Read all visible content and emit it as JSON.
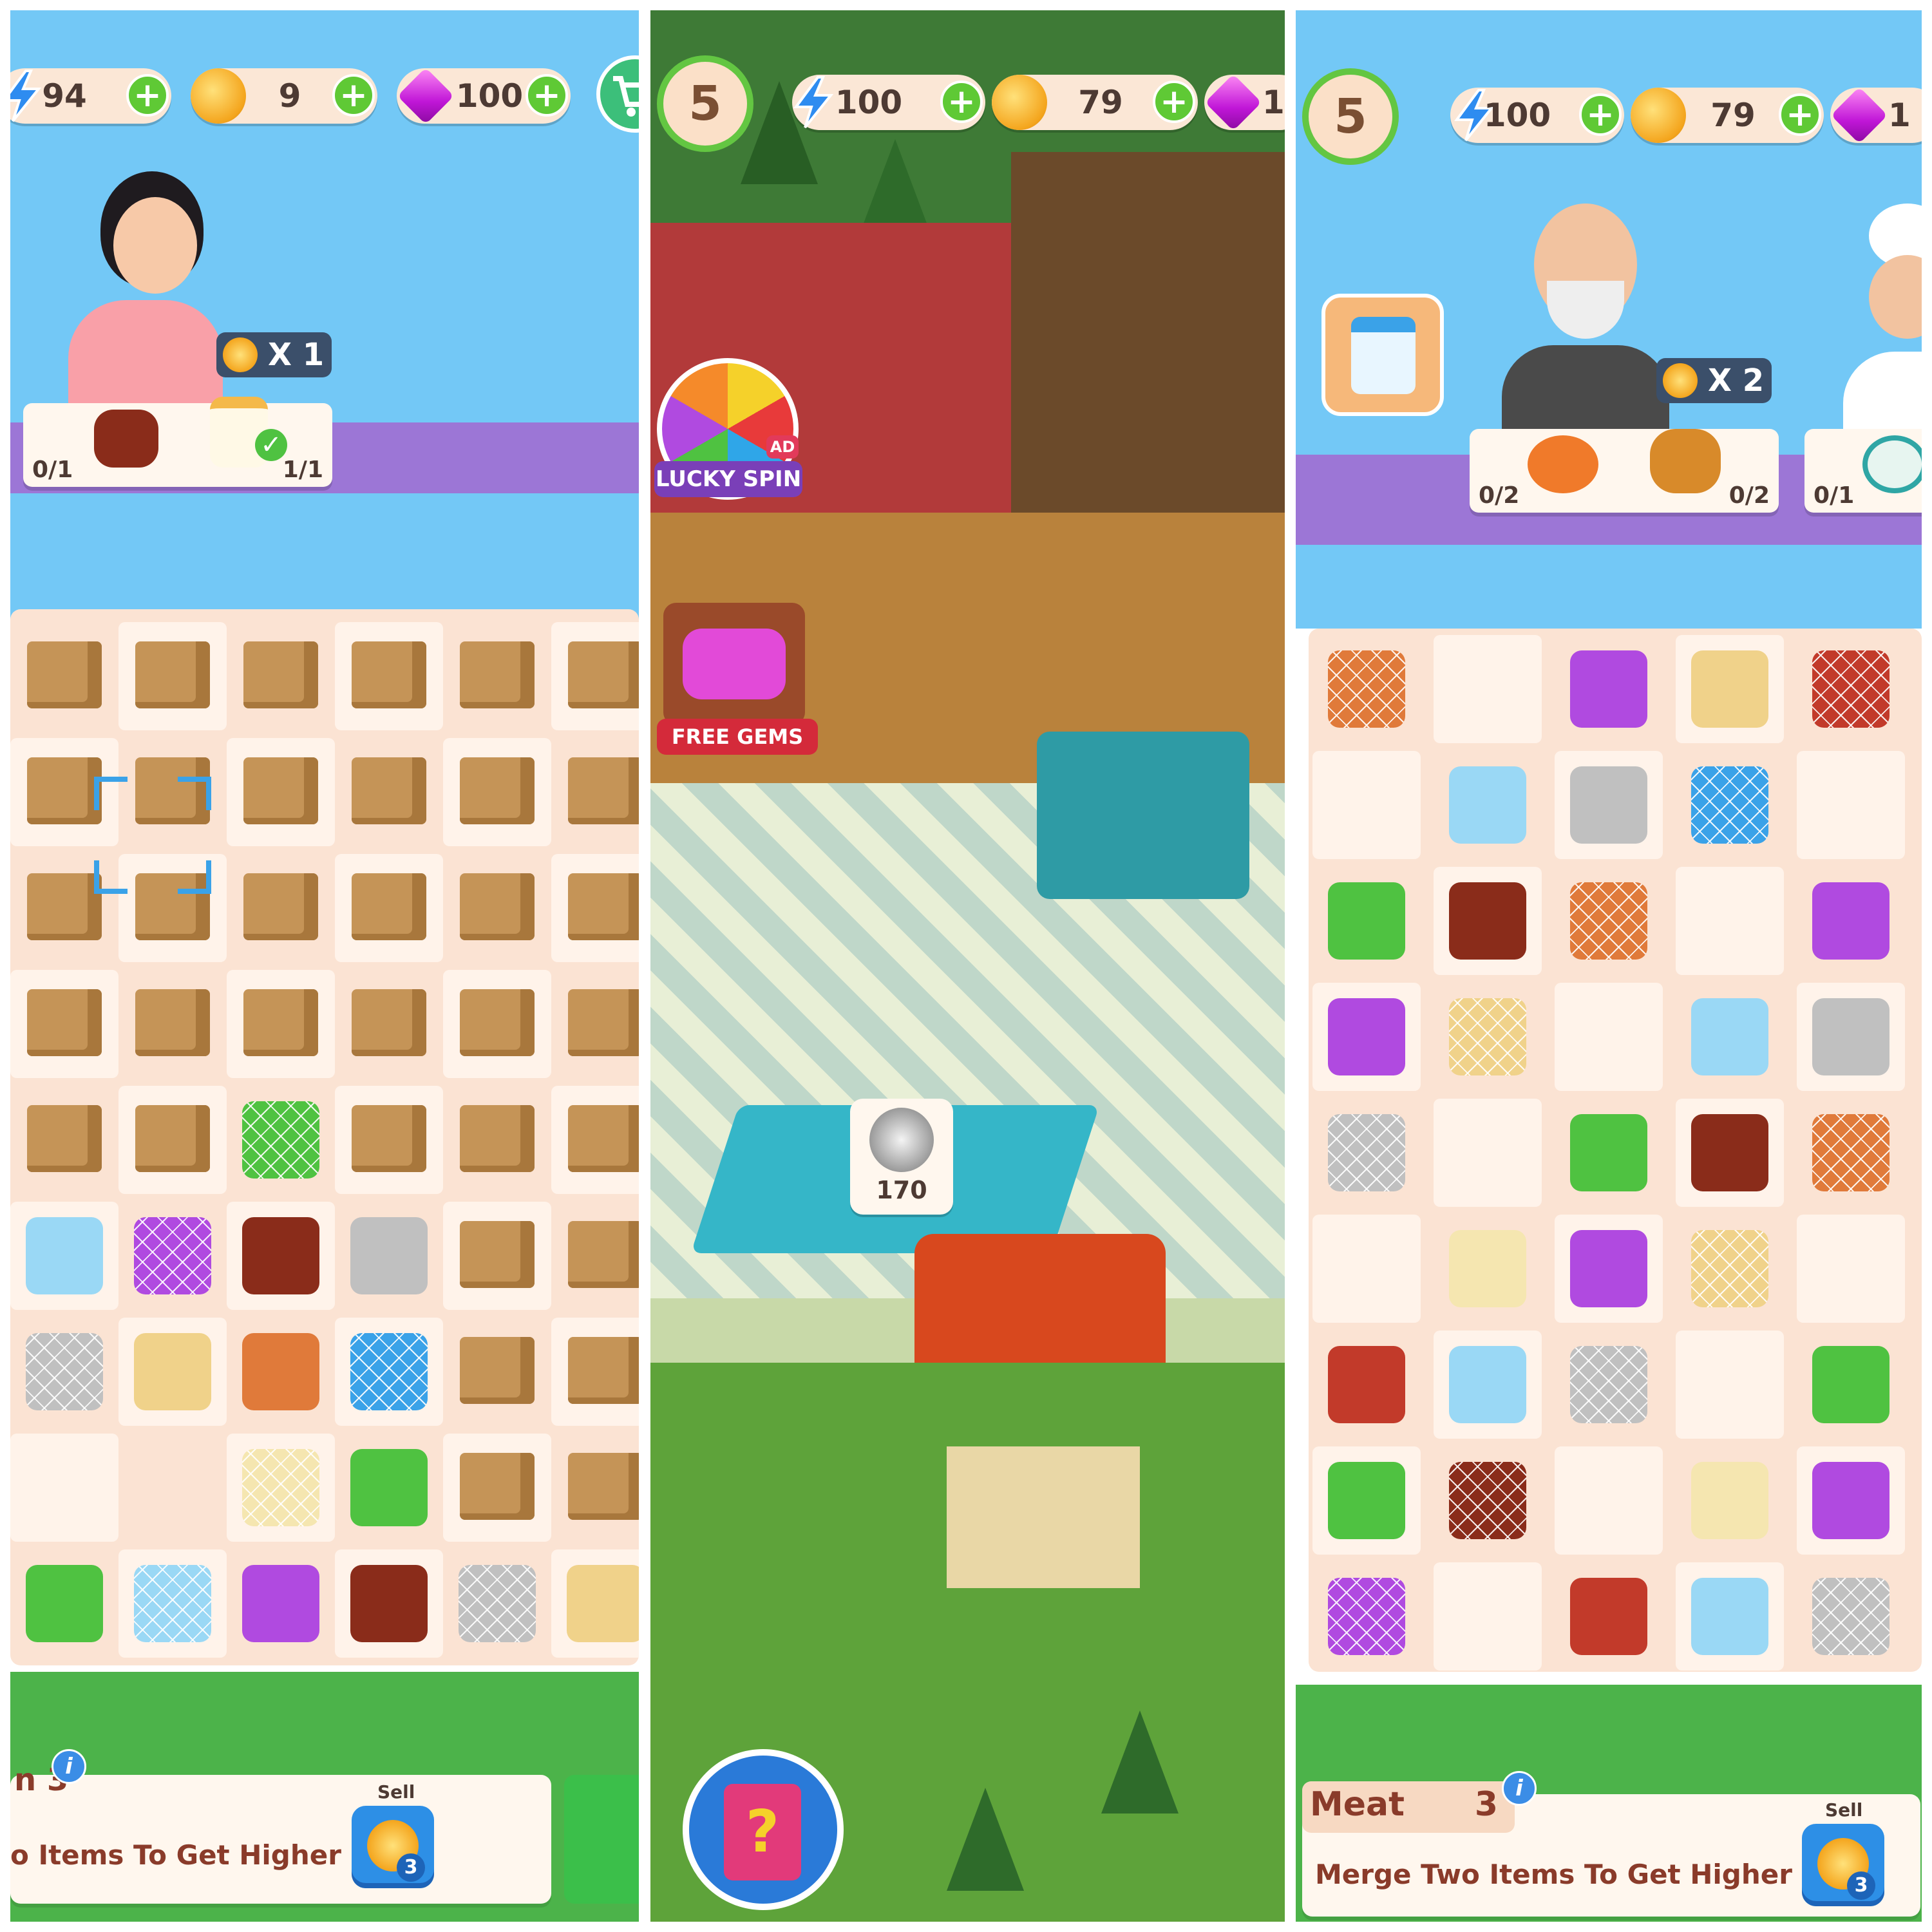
{
  "colors": {
    "accent_green": "#5fc935",
    "sky": "#73c8f6",
    "board": "#fbe3d3",
    "shelf": "#9c76d6"
  },
  "panel1": {
    "energy": "94",
    "coins": "9",
    "gems": "100",
    "order": {
      "reward": "X 1",
      "left_count": "0/1",
      "right_count": "1/1"
    },
    "info": {
      "level_tail": "n 3",
      "hint": "o Items To Get Higher",
      "sell_label": "Sell",
      "sell_value": "3"
    },
    "icons": {
      "energy": "lightning-icon",
      "coins": "pie-coin-icon",
      "gems": "gem-icon",
      "shop": "shopping-cart-icon"
    }
  },
  "panel2": {
    "level": "5",
    "energy": "100",
    "coins": "79",
    "gems": "1",
    "lucky_spin": "LUCKY SPIN",
    "ad_badge": "AD",
    "free_gems": "FREE GEMS",
    "bubble_value": "170",
    "icons": {
      "help": "question-book-icon",
      "plate": "dish-cover-icon"
    }
  },
  "panel3": {
    "level": "5",
    "energy": "100",
    "coins": "79",
    "gems": "1",
    "order": {
      "reward": "X 2",
      "left_count": "0/2",
      "right_count": "0/2",
      "third_count": "0/1"
    },
    "info": {
      "name": "Meat",
      "level": "3",
      "hint": "Merge Two Items To Get Higher",
      "sell_label": "Sell",
      "sell_value": "3"
    }
  }
}
